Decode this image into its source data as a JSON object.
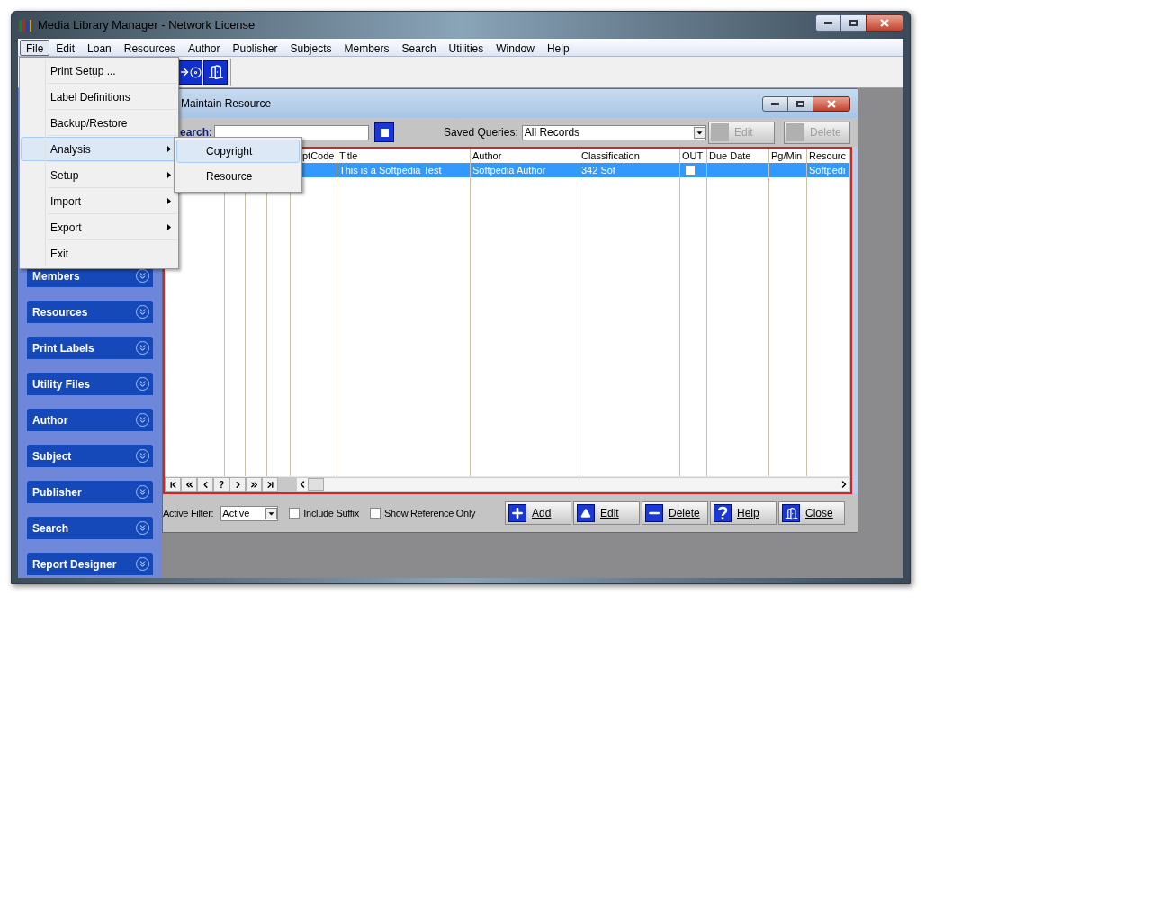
{
  "window": {
    "title": "Media Library Manager - Network License"
  },
  "menubar": [
    {
      "label": "File",
      "selected": true
    },
    {
      "label": "Edit",
      "selected": false
    },
    {
      "label": "Loan",
      "selected": false
    },
    {
      "label": "Resources",
      "selected": false
    },
    {
      "label": "Author",
      "selected": false
    },
    {
      "label": "Publisher",
      "selected": false
    },
    {
      "label": "Subjects",
      "selected": false
    },
    {
      "label": "Members",
      "selected": false
    },
    {
      "label": "Search",
      "selected": false
    },
    {
      "label": "Utilities",
      "selected": false
    },
    {
      "label": "Window",
      "selected": false
    },
    {
      "label": "Help",
      "selected": false
    }
  ],
  "toolbar": [
    {
      "kind": "import"
    },
    {
      "kind": "exit"
    }
  ],
  "file_menu": [
    {
      "label": "Print Setup ...",
      "selected": false,
      "submenu": false
    },
    {
      "label": "Label Definitions",
      "selected": false,
      "submenu": false
    },
    {
      "label": "Backup/Restore",
      "selected": false,
      "submenu": false
    },
    {
      "label": "Analysis",
      "selected": true,
      "submenu": true
    },
    {
      "label": "Setup",
      "selected": false,
      "submenu": true
    },
    {
      "label": "Import",
      "selected": false,
      "submenu": true
    },
    {
      "label": "Export",
      "selected": false,
      "submenu": true
    },
    {
      "label": "Exit",
      "selected": false,
      "submenu": false
    }
  ],
  "analysis_submenu": [
    {
      "label": "Copyright",
      "selected": true
    },
    {
      "label": "Resource",
      "selected": false
    }
  ],
  "sidebar": [
    {
      "label": "Members"
    },
    {
      "label": "Resources"
    },
    {
      "label": "Print Labels"
    },
    {
      "label": "Utility Files"
    },
    {
      "label": "Author"
    },
    {
      "label": "Subject"
    },
    {
      "label": "Publisher"
    },
    {
      "label": "Search"
    },
    {
      "label": "Report Designer"
    }
  ],
  "child_window": {
    "title": "Maintain Resource",
    "search_label": "earch:",
    "saved_queries_label": "Saved Queries:",
    "saved_query": "All Records",
    "top_buttons": [
      {
        "label": "Edit",
        "disabled": true
      },
      {
        "label": "Delete",
        "disabled": true
      }
    ],
    "columns": [
      "ptCode",
      "Title",
      "Author",
      "Classification",
      "OUT",
      "Due Date",
      "Pg/Min",
      "Resourc"
    ],
    "rows": [
      {
        "selected": true,
        "title": "This is a Softpedia Test",
        "author": "Softpedia Author",
        "classification": "342 Sof",
        "out": false,
        "resource": "Softpedi"
      }
    ],
    "navigator": [
      {
        "kind": "first"
      },
      {
        "kind": "prev_page"
      },
      {
        "kind": "prev"
      },
      {
        "kind": "refresh",
        "label": "?"
      },
      {
        "kind": "next"
      },
      {
        "kind": "next_page"
      },
      {
        "kind": "last"
      }
    ],
    "active_filter": {
      "label": "Active Filter:",
      "value": "Active"
    },
    "checkboxes": [
      {
        "label": "Include Suffix",
        "checked": false
      },
      {
        "label": "Show Reference Only",
        "checked": false
      }
    ],
    "buttons": [
      {
        "label": "Add",
        "kind": "add"
      },
      {
        "label": "Edit",
        "kind": "edit"
      },
      {
        "label": "Delete",
        "kind": "delete"
      },
      {
        "label": "Help",
        "kind": "help"
      },
      {
        "label": "Close",
        "kind": "close"
      }
    ]
  }
}
